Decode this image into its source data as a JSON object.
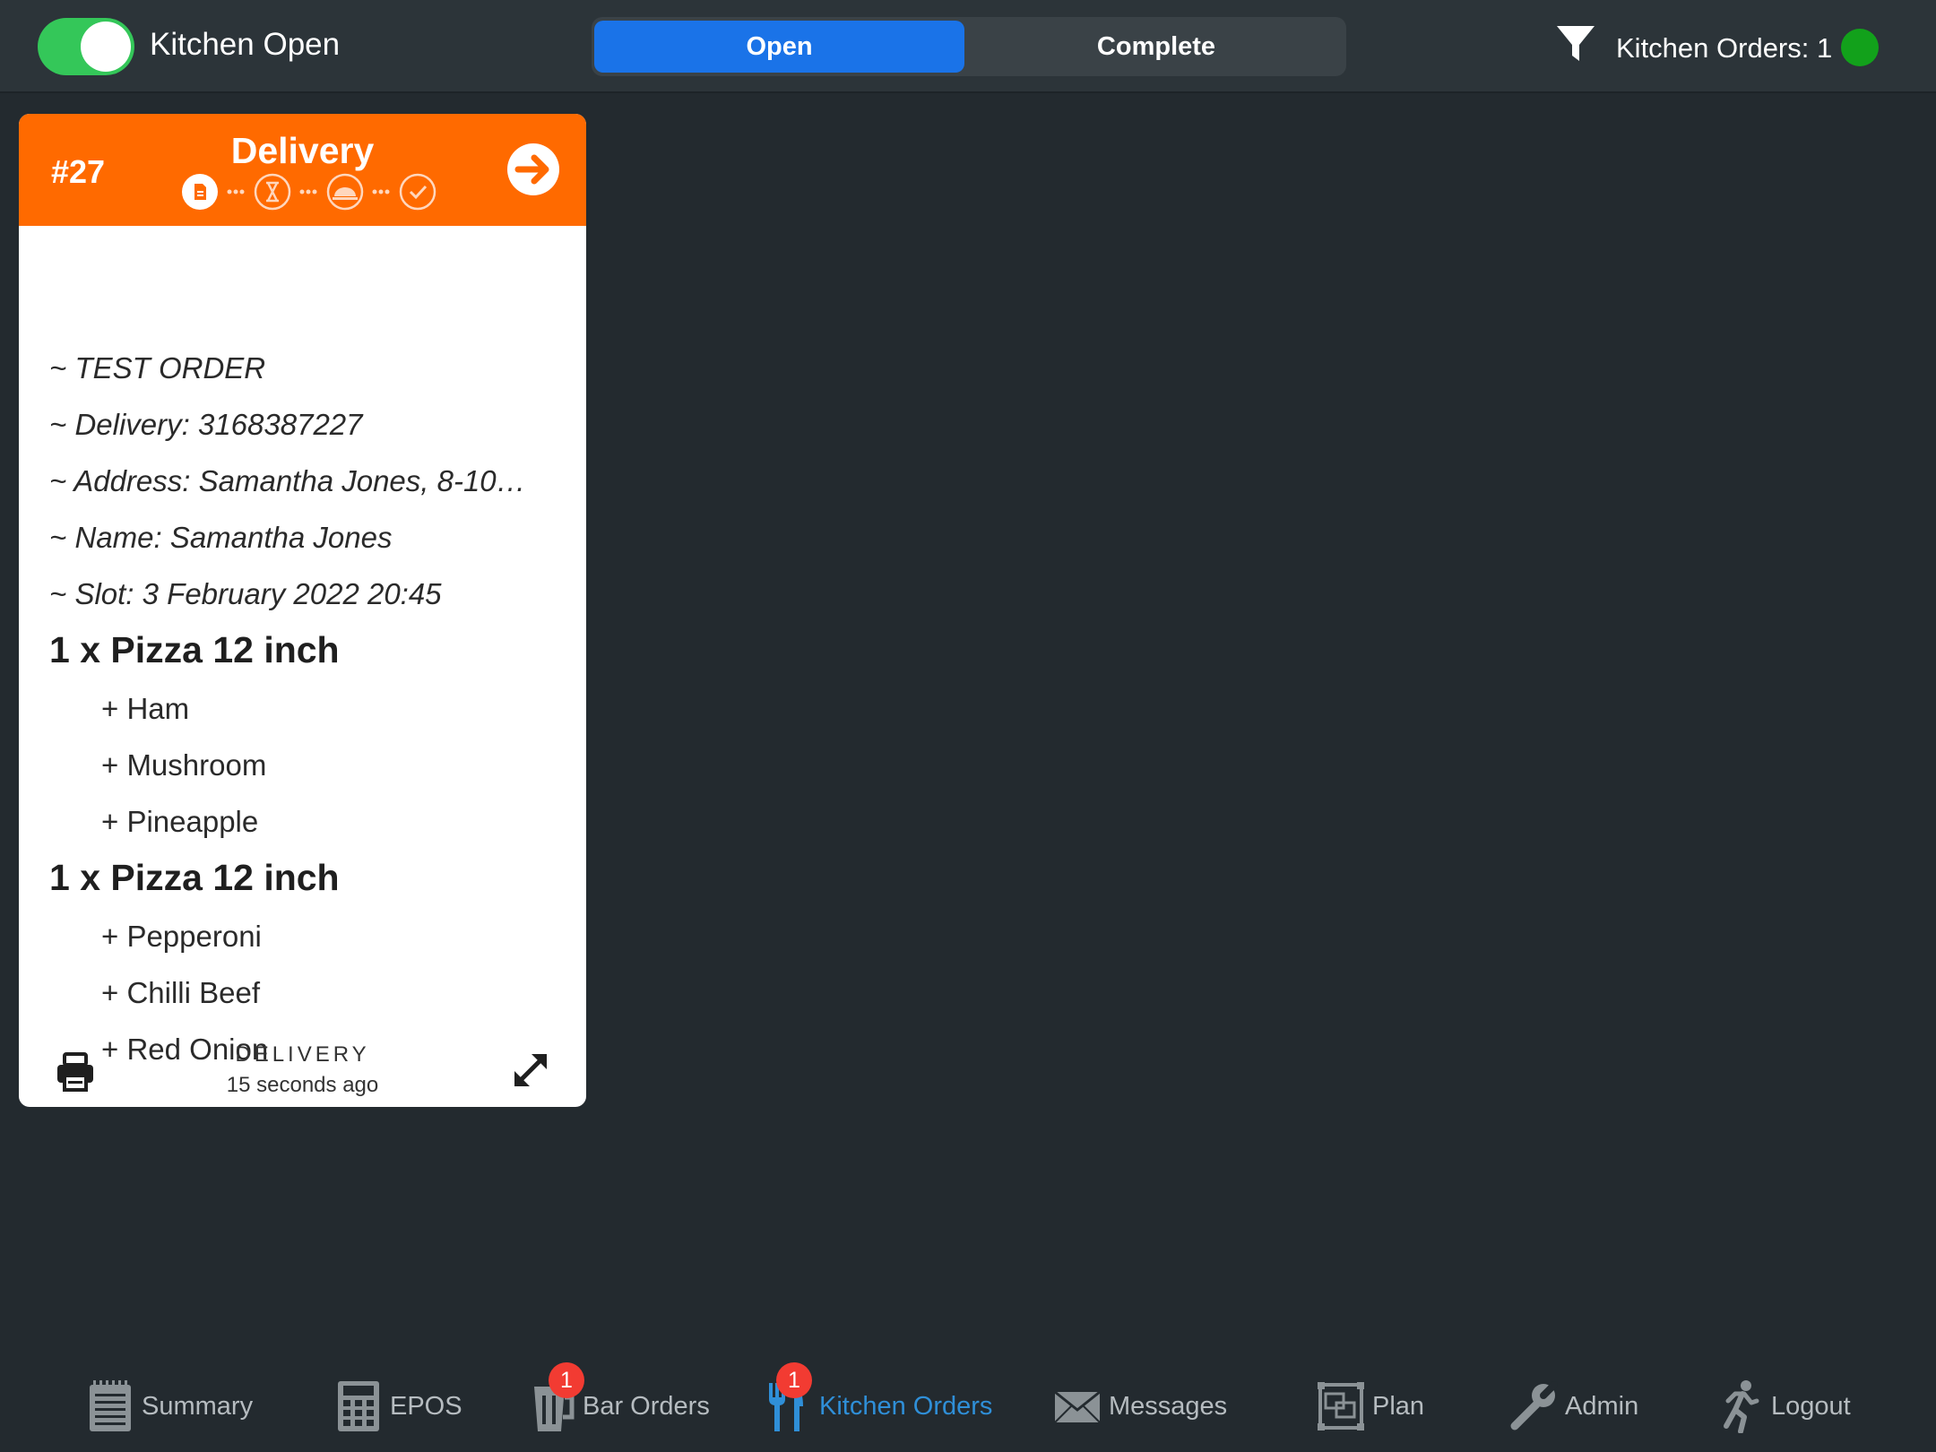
{
  "topbar": {
    "kitchen_toggle_label": "Kitchen Open",
    "kitchen_toggle_on": true,
    "segments": {
      "open": "Open",
      "complete": "Complete",
      "active": "open"
    },
    "orders_count_label": "Kitchen Orders: 1",
    "status_color": "#12a11b",
    "filter_icon": "filter-icon"
  },
  "order": {
    "number": "#27",
    "type": "Delivery",
    "header_color": "#ff6a00",
    "progress_steps": [
      "document-icon",
      "hourglass-icon",
      "cloche-icon",
      "check-icon"
    ],
    "notes": [
      "~ TEST ORDER",
      "~ Delivery: 3168387227",
      "~ Address: Samantha Jones, 8-10…",
      "~ Name: Samantha Jones",
      "~ Slot: 3 February 2022 20:45"
    ],
    "items": [
      {
        "name": "1 x Pizza 12 inch",
        "modifiers": [
          "+ Ham",
          "+ Mushroom",
          "+ Pineapple"
        ]
      },
      {
        "name": "1 x Pizza 12 inch",
        "modifiers": [
          "+ Pepperoni",
          "+ Chilli Beef",
          "+ Red Onion"
        ]
      }
    ],
    "footer_type": "DELIVERY",
    "footer_time": "15 seconds ago"
  },
  "tabbar": {
    "tabs": [
      {
        "label": "Summary",
        "icon": "notepad-icon"
      },
      {
        "label": "EPOS",
        "icon": "calculator-icon"
      },
      {
        "label": "Bar Orders",
        "icon": "glass-icon",
        "badge": "1"
      },
      {
        "label": "Kitchen Orders",
        "icon": "fork-knife-icon",
        "badge": "1",
        "active": true
      },
      {
        "label": "Messages",
        "icon": "envelope-icon"
      },
      {
        "label": "Plan",
        "icon": "floor-plan-icon"
      },
      {
        "label": "Admin",
        "icon": "wrench-icon"
      },
      {
        "label": "Logout",
        "icon": "running-man-icon"
      }
    ],
    "active_color": "#2f8fd8",
    "badge_color": "#f23b32"
  }
}
